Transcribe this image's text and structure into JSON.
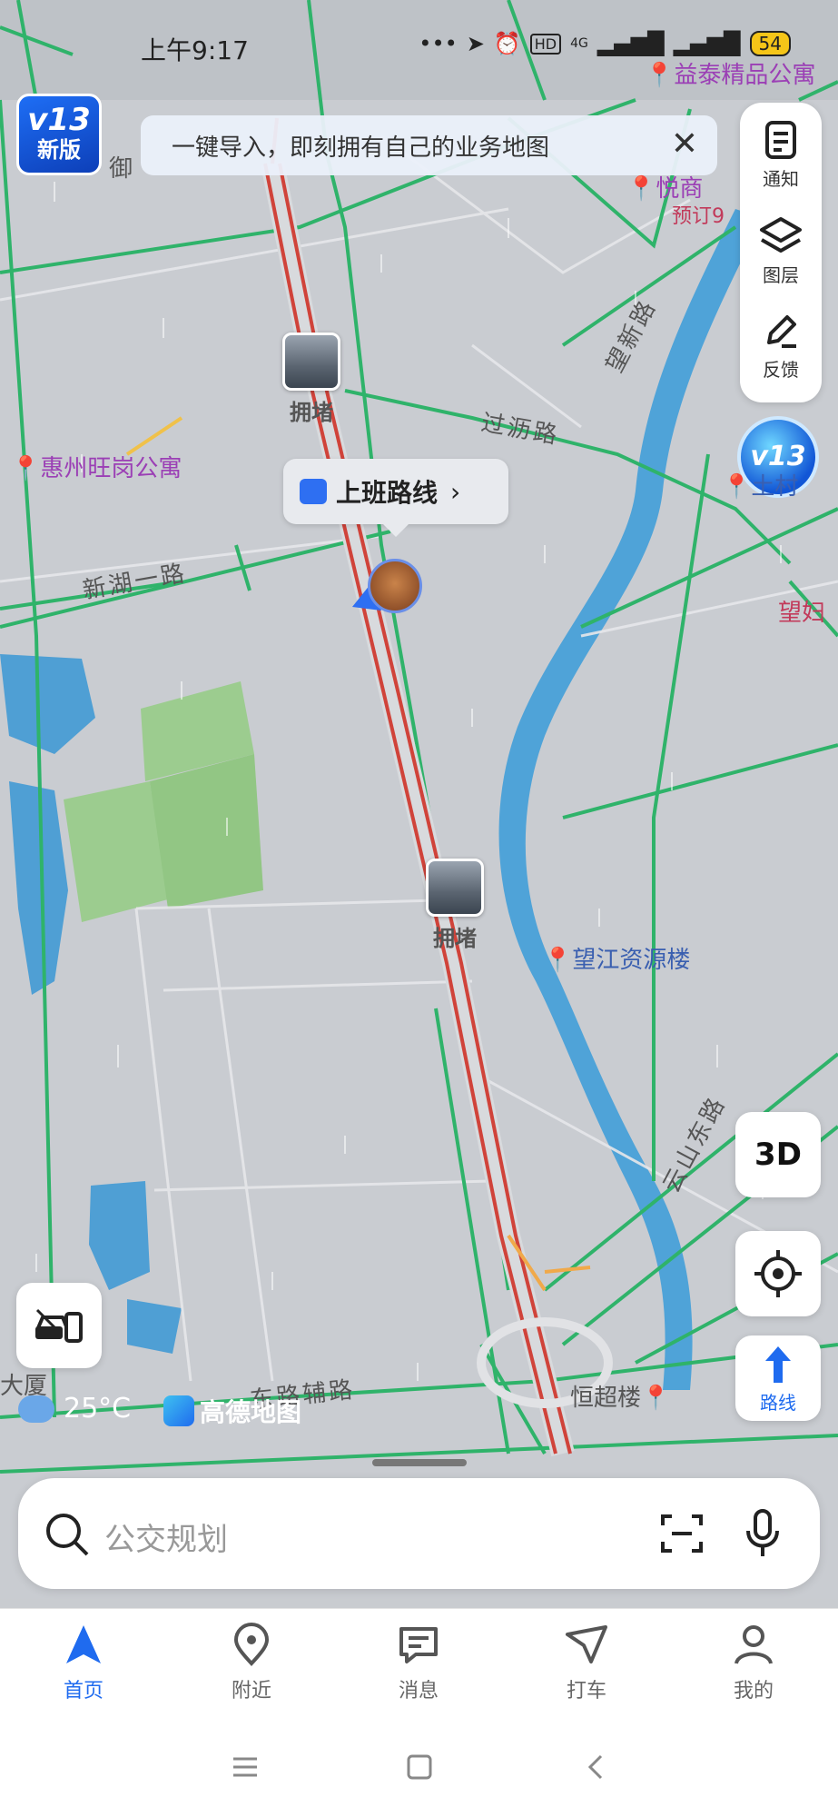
{
  "status_bar": {
    "time": "上午9:17",
    "network_label": "4G",
    "hd_label": "HD",
    "battery": "54"
  },
  "promo": {
    "badge_version": "v13",
    "badge_text": "新版"
  },
  "banner": {
    "text": "一键导入，即刻拥有自己的业务地图"
  },
  "right_panel": {
    "items": [
      {
        "label": "通知",
        "icon": "notice-icon"
      },
      {
        "label": "图层",
        "icon": "layers-icon"
      },
      {
        "label": "反馈",
        "icon": "feedback-icon"
      }
    ],
    "orb_text": "v13"
  },
  "commute": {
    "label": "上班路线",
    "chevron": "›"
  },
  "map": {
    "pois": [
      {
        "text": "惠州旺岗公寓",
        "color": "#9b3fb5"
      },
      {
        "text": "益泰精品公寓",
        "color": "#9b3fb5"
      },
      {
        "text": "悦商",
        "color": "#9b3fb5"
      },
      {
        "text": "预订9",
        "color": "#c23a5a"
      },
      {
        "text": "望江资源楼",
        "color": "#3a5fb0"
      },
      {
        "text": "恒超楼",
        "color": "#555555"
      },
      {
        "text": "土村",
        "color": "#3a5fb0"
      },
      {
        "text": "望妇",
        "color": "#c23a5a"
      },
      {
        "text": "御",
        "color": "#555555"
      },
      {
        "text": "大厦",
        "color": "#555555"
      }
    ],
    "roads": [
      "过沥路",
      "望新路",
      "新湖一路",
      "云山东路",
      "东路辅路"
    ],
    "jams": [
      "拥堵",
      "拥堵"
    ]
  },
  "buttons": {
    "three_d": "3D",
    "route": "路线"
  },
  "weather": {
    "temp": "25°C",
    "brand": "高德地图"
  },
  "search": {
    "placeholder": "公交规划"
  },
  "tabs": [
    {
      "label": "首页",
      "active": true
    },
    {
      "label": "附近",
      "active": false
    },
    {
      "label": "消息",
      "active": false
    },
    {
      "label": "打车",
      "active": false
    },
    {
      "label": "我的",
      "active": false
    }
  ],
  "colors": {
    "accent": "#1f6bef",
    "water": "#4aa0d8",
    "park": "#9ccc8f",
    "congestion": "#d0433a",
    "smooth": "#2fb36a"
  }
}
